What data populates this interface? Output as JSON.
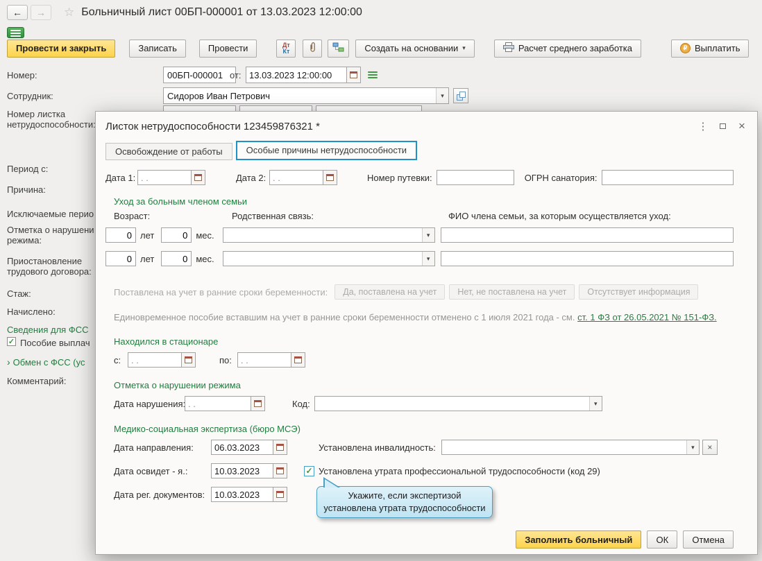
{
  "icons": {
    "back": "←",
    "forward": "→",
    "star": "☆",
    "caret": "▾",
    "more": "⋮",
    "close": "×",
    "check": "✓",
    "chevron": "›",
    "ruble": "₽",
    "dt": "Дт",
    "kt": "Кт",
    "clear": "×"
  },
  "colors": {
    "accent_yellow": "#fed34a",
    "section_green": "#1e7e3e",
    "active_tab_border": "#1f93c8",
    "tooltip_blue": "#bfe4f3"
  },
  "header": {
    "title": "Больничный лист 00БП-000001 от 13.03.2023 12:00:00"
  },
  "toolbar": {
    "post_and_close": "Провести и закрыть",
    "write": "Записать",
    "post": "Провести",
    "create_on_basis": "Создать на основании",
    "avg_calc": "Расчет среднего заработка",
    "pay": "Выплатить"
  },
  "form": {
    "number_label": "Номер:",
    "number_value": "00БП-000001",
    "from_label": "от:",
    "from_value": "13.03.2023 12:00:00",
    "employee_label": "Сотрудник:",
    "employee_value": "Сидоров Иван Петрович",
    "left_labels": {
      "sick_number_1": "Номер листка",
      "sick_number_2": "нетрудоспособности:",
      "period": "Период с:",
      "reason": "Причина:",
      "excluded": "Исключаемые перио",
      "violation_1": "Отметка о нарушени",
      "violation_2": "режима:",
      "suspension_1": "Приостановление",
      "suspension_2": "трудового договора:",
      "experience": "Стаж:",
      "accrued": "Начислено:",
      "fss_info": "Сведения для ФСС",
      "benefit_paid": "Пособие выплач",
      "fss_exchange": "Обмен с ФСС (ус",
      "comment": "Комментарий:"
    }
  },
  "dialog": {
    "title": "Листок нетрудоспособности 123459876321 *",
    "tab_release": "Освобождение от работы",
    "tab_special": "Особые причины нетрудоспособности",
    "row1": {
      "date1_label": "Дата 1:",
      "date1_value": ". .",
      "date2_label": "Дата 2:",
      "date2_value": ". .",
      "voucher_label": "Номер путевки:",
      "voucher_value": "",
      "ogrn_label": "ОГРН санатория:",
      "ogrn_value": ""
    },
    "care": {
      "header": "Уход за больным членом семьи",
      "age_label": "Возраст:",
      "relation_label": "Родственная связь:",
      "fio_label": "ФИО члена семьи, за которым осуществляется уход:",
      "years_suffix": "лет",
      "months_suffix": "мес.",
      "row1": {
        "years": "0",
        "months": "0",
        "relation": "",
        "fio": ""
      },
      "row2": {
        "years": "0",
        "months": "0",
        "relation": "",
        "fio": ""
      }
    },
    "pregnancy": {
      "label": "Поставлена на учет в ранние сроки беременности:",
      "btn_yes": "Да, поставлена на учет",
      "btn_no": "Нет, не поставлена на учет",
      "btn_unknown": "Отсутствует информация",
      "note": "Единовременное пособие вставшим на учет в ранние сроки беременности отменено с 1 июля 2021 года - см.",
      "note_link": "ст. 1 ФЗ от 26.05.2021 № 151-ФЗ."
    },
    "hospital": {
      "header": "Находился в стационаре",
      "from_label": "с:",
      "from_value": ". .",
      "to_label": "по:",
      "to_value": ". ."
    },
    "violation": {
      "header": "Отметка о нарушении режима",
      "date_label": "Дата нарушения:",
      "date_value": ". .",
      "code_label": "Код:",
      "code_value": ""
    },
    "mse": {
      "header": "Медико-социальная экспертиза (бюро МСЭ)",
      "direction_label": "Дата направления:",
      "direction_value": "06.03.2023",
      "disability_label": "Установлена инвалидность:",
      "disability_value": "",
      "exam_label": "Дата освидет - я.:",
      "exam_value": "10.03.2023",
      "loss_label": "Установлена утрата профессиональной трудоспособности (код 29)",
      "docs_label": "Дата рег. документов:",
      "docs_value": "10.03.2023"
    },
    "tooltip": {
      "line1": "Укажите, если экспертизой",
      "line2": "установлена утрата трудоспособности"
    },
    "footer": {
      "fill": "Заполнить больничный",
      "ok": "ОК",
      "cancel": "Отмена"
    }
  }
}
